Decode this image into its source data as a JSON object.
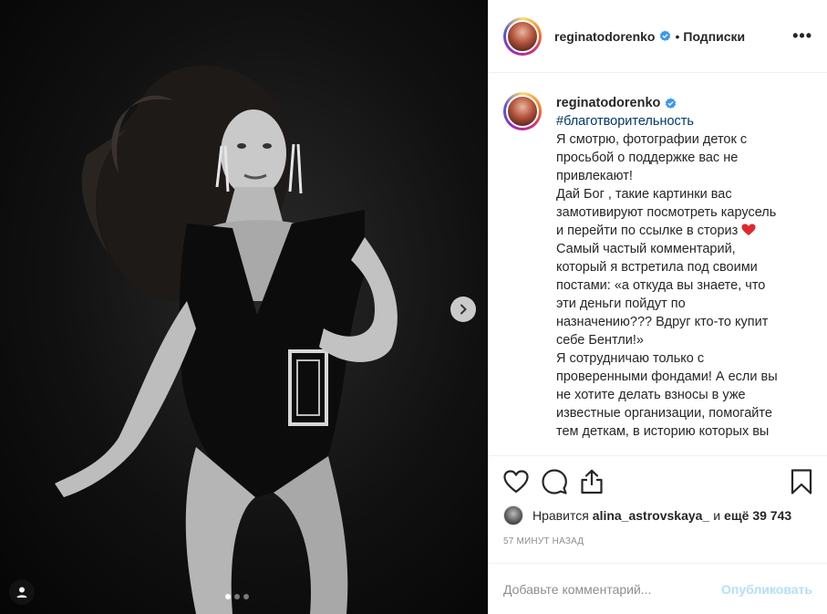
{
  "post": {
    "username": "reginatodorenko",
    "verified": true,
    "follow_separator": "•",
    "follow_label": "Подписки",
    "more_label": "•••"
  },
  "caption": {
    "username": "reginatodorenko",
    "hashtag": "#благотворительность",
    "lines": [
      "Я смотрю, фотографии деток с",
      "просьбой о поддержке вас не",
      "привлекают!",
      "Дай Бог , такие картинки вас",
      "замотивируют посмотреть карусель",
      "и перейти по ссылке в сториз",
      "Самый частый комментарий,",
      "который я встретила под своими",
      "постами: «а откуда вы знаете, что",
      "эти деньги пойдут по",
      "назначению??? Вдруг кто-то купит",
      "себе Бентли!»",
      "Я сотрудничаю только с",
      "проверенными фондами! А если вы",
      "не хотите делать взносы в уже",
      "известные организации, помогайте",
      "тем деткам, в историю которых вы"
    ]
  },
  "likes": {
    "prefix": "Нравится",
    "user": "alina_astrovskaya_",
    "and": "и",
    "count": "ещё 39 743"
  },
  "timestamp": "57 МИНУТ НАЗАД",
  "comment": {
    "placeholder": "Добавьте комментарий...",
    "publish_label": "Опубликовать"
  },
  "carousel": {
    "total": 3,
    "current": 1
  },
  "colors": {
    "verified": "#3897f0",
    "hashtag": "#00376b",
    "publish_disabled": "#b2dffc",
    "heart": "#ed4956"
  },
  "icons": [
    "heart-icon",
    "comment-icon",
    "share-icon",
    "bookmark-icon",
    "chevron-right-icon",
    "user-tag-icon",
    "verified-badge-icon"
  ]
}
